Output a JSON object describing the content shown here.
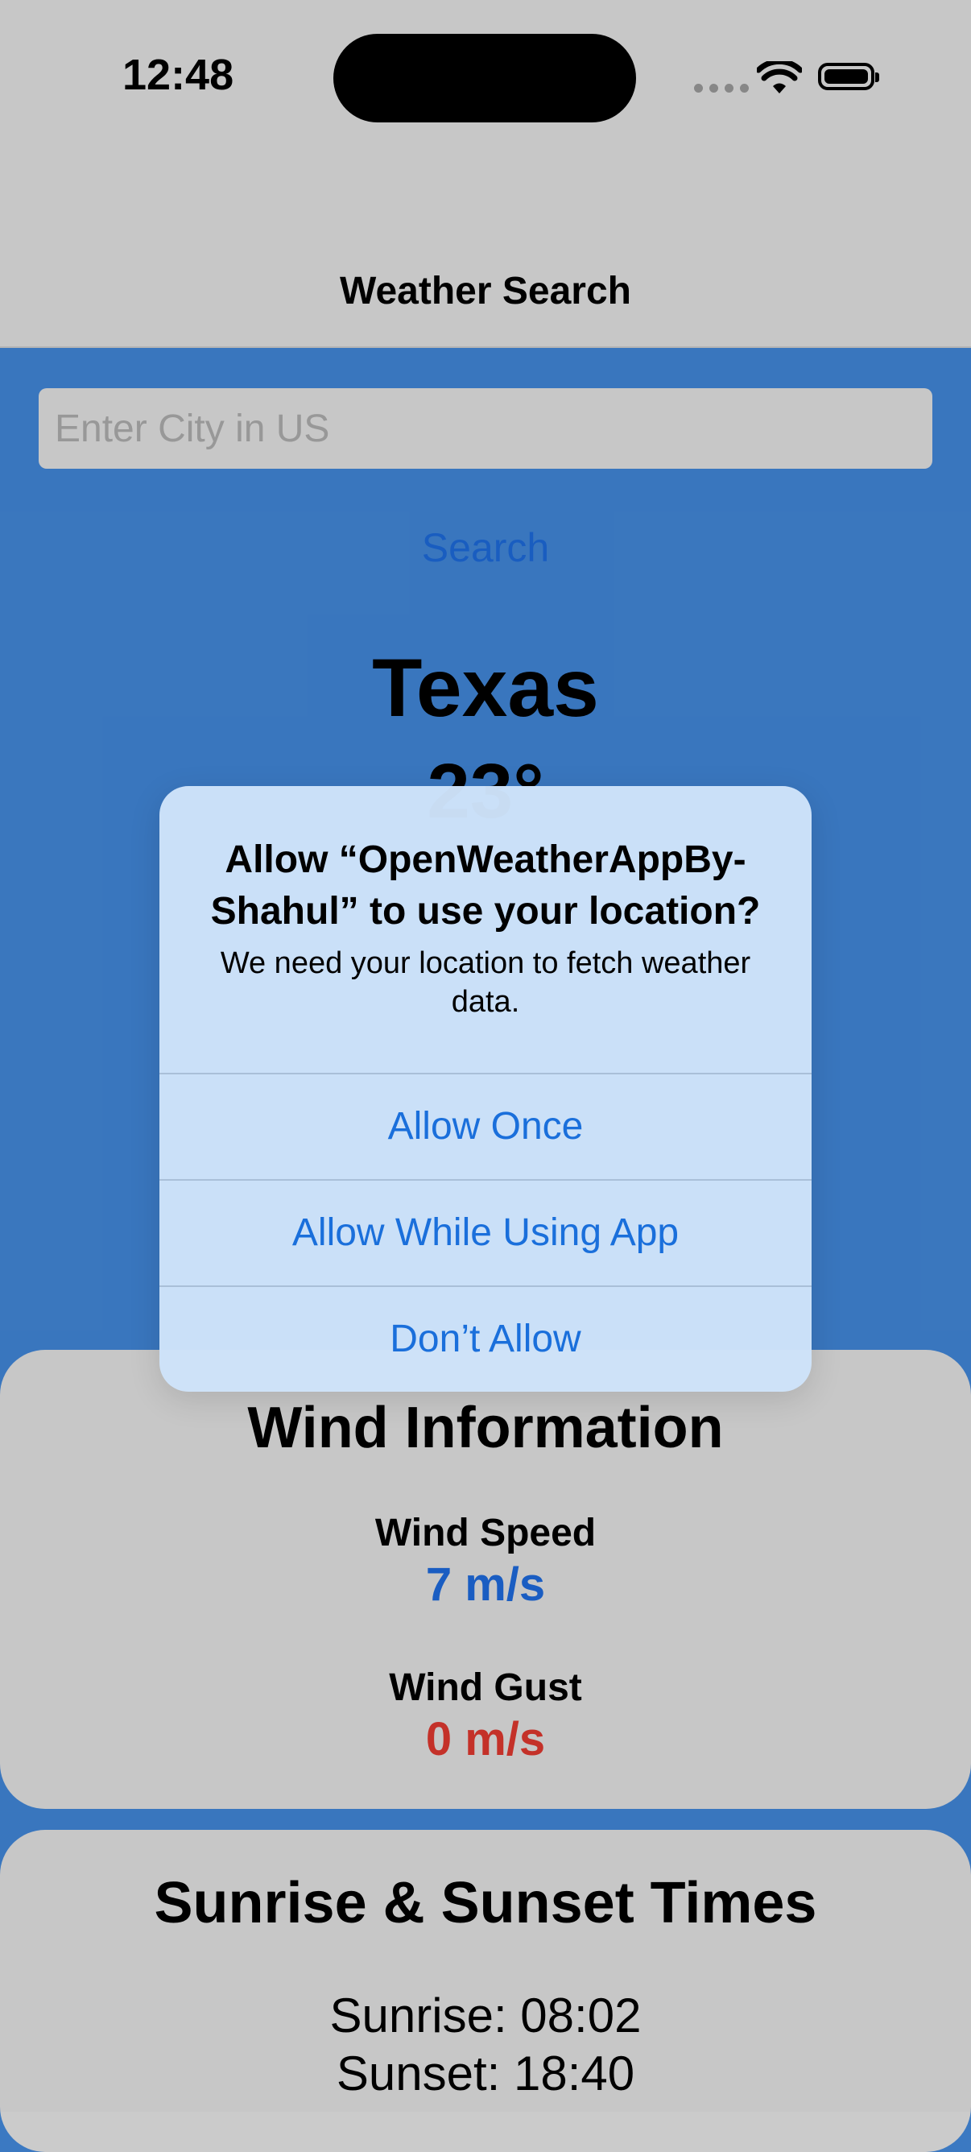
{
  "status_bar": {
    "time": "12:48"
  },
  "nav": {
    "title": "Weather Search"
  },
  "search": {
    "placeholder": "Enter City in US",
    "value": "",
    "button_label": "Search"
  },
  "weather": {
    "city": "Texas",
    "temperature": "23°"
  },
  "wind_card": {
    "title": "Wind Information",
    "speed_label": "Wind Speed",
    "speed_value": "7 m/s",
    "gust_label": "Wind Gust",
    "gust_value": "0 m/s"
  },
  "sun_card": {
    "title": "Sunrise & Sunset Times",
    "sunrise": "Sunrise: 08:02",
    "sunset": "Sunset: 18:40"
  },
  "alert": {
    "title": "Allow “OpenWeatherAppBy-Shahul” to use your location?",
    "message": "We need your location to fetch weather data.",
    "buttons": {
      "allow_once": "Allow Once",
      "allow_while_using": "Allow While Using App",
      "dont_allow": "Don’t Allow"
    }
  },
  "colors": {
    "background": "#3b79c2",
    "panel": "#cbcbcb",
    "accent_blue": "#1a6fdb",
    "wind_speed": "#1b5fc6",
    "wind_gust": "#c8322a"
  }
}
